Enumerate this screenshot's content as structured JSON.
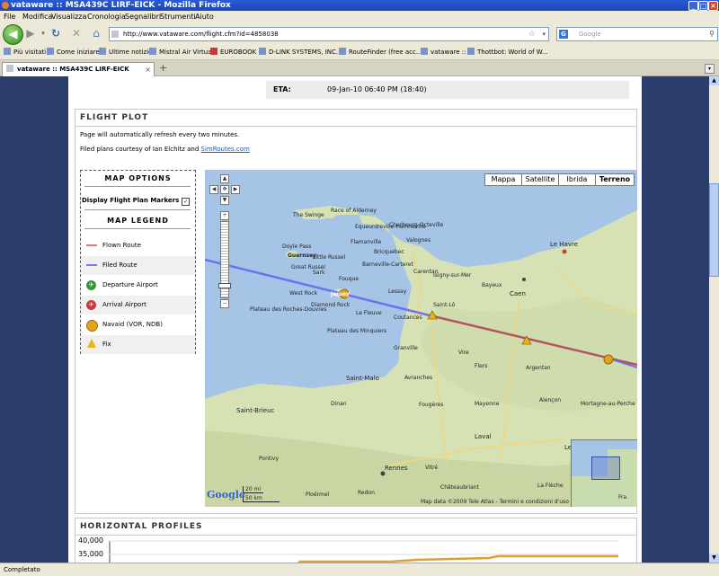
{
  "window": {
    "title": "vataware :: MSA439C LIRF-EICK - Mozilla Firefox"
  },
  "menu": [
    "File",
    "Modifica",
    "Visualizza",
    "Cronologia",
    "Segnalibri",
    "Strumenti",
    "Aiuto"
  ],
  "navbar": {
    "url": "http://www.vataware.com/flight.cfm?id=4858038",
    "search_engine": "G",
    "search_placeholder": "Google"
  },
  "bookmarks": [
    "Più visitati",
    "Come iniziare",
    "Ultime notizie",
    "Mistral Air Virtual",
    "EUROBOOK",
    "D-LINK SYSTEMS, INC...",
    "RouteFinder (free acc...",
    "vataware ::",
    "Thottbot: World of W..."
  ],
  "tabs": [
    {
      "label": "vataware :: MSA439C LIRF-EICK"
    }
  ],
  "eta": {
    "label": "ETA:",
    "value": "09-Jan-10 06:40 PM (18:40)"
  },
  "flight_plot": {
    "heading": "FLIGHT PLOT",
    "refresh_note": "Page will automatically refresh every two minutes.",
    "credit_prefix": "Filed plans courtesy of Ian Elchitz and ",
    "credit_link": "SimRoutes.com"
  },
  "map_options": {
    "heading": "MAP OPTIONS",
    "display_markers_label": "Display Flight Plan Markers",
    "display_markers_checked": true,
    "check_glyph": "✓",
    "legend_heading": "MAP LEGEND",
    "legend": [
      {
        "label": "Flown Route",
        "color": "#e07a7a"
      },
      {
        "label": "Filed Route",
        "color": "#7a7ae8"
      },
      {
        "label": "Departure Airport",
        "color": "#3a9a3a"
      },
      {
        "label": "Arrival Airport",
        "color": "#c83a3a"
      },
      {
        "label": "Navaid (VOR, NDB)",
        "color": "#e0a418"
      },
      {
        "label": "Fix",
        "color": "#e8b418"
      }
    ]
  },
  "map": {
    "types": [
      "Mappa",
      "Satellite",
      "Ibrida",
      "Terreno"
    ],
    "selected_type": "Terreno",
    "labels": {
      "the_swinge": "The Swinge",
      "race_of_alderney": "Race of Alderney",
      "equeurdreville": "Equeurdreville-Hainneville",
      "cherbourg": "Cherbourg-Octeville",
      "valognes": "Valognes",
      "flamanville": "Flamanville",
      "bricquebec": "Bricquebec",
      "le_havre": "Le Havre",
      "doyle_pass": "Doyle Pass",
      "guernsey": "Guernsey",
      "great_russel": "Great Russel",
      "little_russel": "Little Russel",
      "barneville": "Barneville-Carteret",
      "sark": "Sark",
      "fouque": "Fouque",
      "lessay": "Lessay",
      "carentan": "Carentan",
      "isigny": "Isigny-sur-Mer",
      "bayeux": "Bayeux",
      "caen": "Caen",
      "west_rock": "West Rock",
      "jersey": "Jersey",
      "diamond_rock": "Diamond Rock",
      "le_fleuve": "Le Fleuve",
      "coutances": "Coutances",
      "saint_lo": "Saint-Lô",
      "vire": "Vire",
      "roches_douvres": "Plateau des Roches-Douvres",
      "minquiers": "Plateau des Minquiers",
      "granville": "Granville",
      "argentan": "Argentan",
      "flers": "Flers",
      "avranches": "Avranches",
      "saint_malo": "Saint-Malo",
      "fougeres": "Fougères",
      "alencon": "Alençon",
      "mayenne": "Mayenne",
      "saint_brieuc": "Saint-Brieuc",
      "dinan": "Dinan",
      "laval": "Laval",
      "rennes": "Rennes",
      "vitre": "Vitré",
      "mortagne": "Mortagne-au-Perche",
      "la_fleche": "La Flèche",
      "le_mans": "Le Mans",
      "ploermel": "Ploërmel",
      "chateaubriant": "Châteaubriant",
      "pontivy": "Pontivy",
      "redon": "Redon",
      "fra": "Fra"
    },
    "scale_mi": "20 mi",
    "scale_km": "50 km",
    "copyright": "Map data ©2009 Tele Atlas - Termini e condizioni d'uso",
    "logo": "Google"
  },
  "horizontal_profiles": {
    "heading": "HORIZONTAL PROFILES",
    "ticks": [
      "40,000",
      "35,000"
    ]
  },
  "status": {
    "text": "Completato"
  }
}
